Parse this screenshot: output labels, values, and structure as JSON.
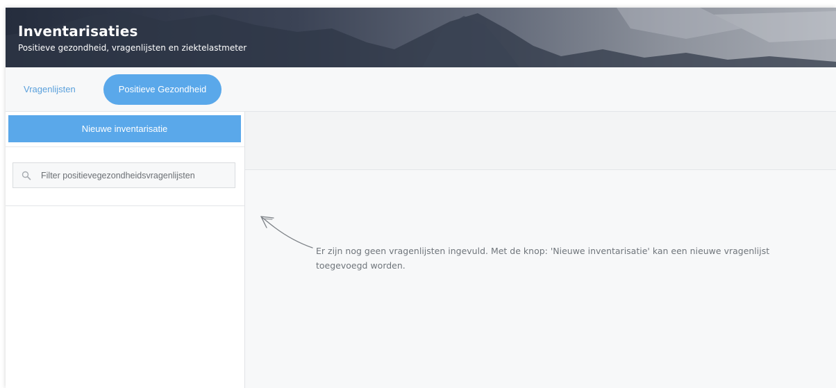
{
  "header": {
    "title": "Inventarisaties",
    "subtitle": "Positieve gezondheid, vragenlijsten en ziektelastmeter"
  },
  "tabs": [
    {
      "label": "Vragenlijsten",
      "active": false
    },
    {
      "label": "Positieve Gezondheid",
      "active": true
    }
  ],
  "sidebar": {
    "new_button_label": "Nieuwe inventarisatie",
    "filter_placeholder": "Filter positievegezondheidsvragenlijsten",
    "filter_value": ""
  },
  "main": {
    "empty_message": "Er zijn nog geen vragenlijsten ingevuld. Met de knop: 'Nieuwe inventarisatie' kan een nieuwe vragenlijst toegevoegd worden."
  },
  "colors": {
    "accent": "#5aa8ea",
    "tab_text": "#5aa0dc",
    "message_text": "#6f757b"
  },
  "icons": {
    "filter": "search-icon",
    "hint": "curved-arrow-icon"
  }
}
